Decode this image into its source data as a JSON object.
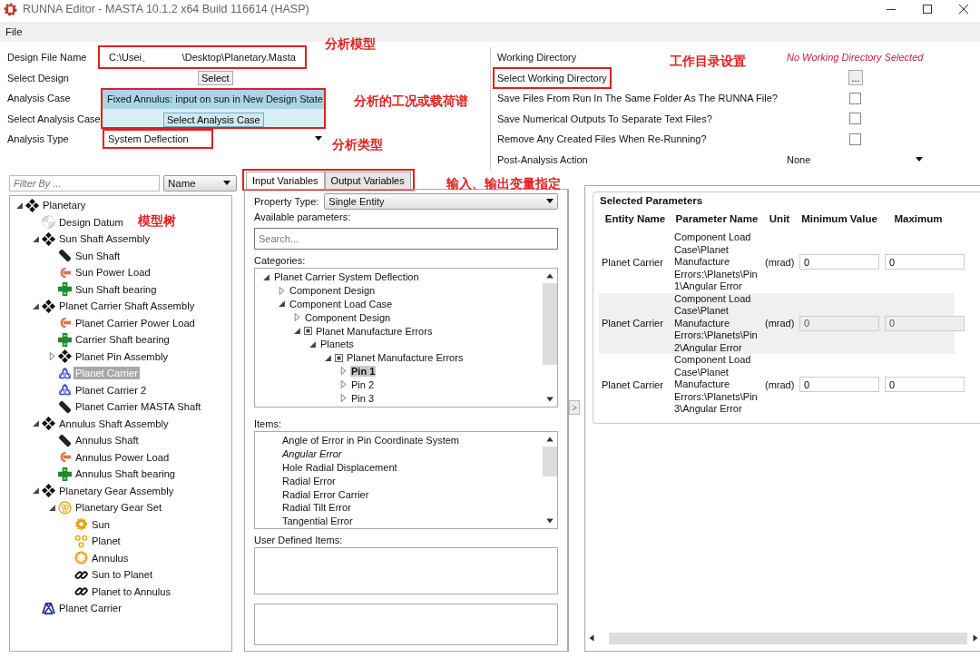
{
  "window": {
    "title": "RUNNA Editor - MASTA 10.1.2 x64 Build 116614 (HASP)"
  },
  "menu": [
    "File"
  ],
  "design": {
    "file": {
      "label": "Design File Name",
      "value": "C:\\Usei、           \\Desktop\\Planetary.Masta",
      "highlighted": true
    },
    "select_design": {
      "label": "Select Design",
      "button": "Select"
    },
    "analysis_case": {
      "label": "Analysis Case",
      "value": "Fixed Annulus: input on sun in New Design State",
      "select_label": "Select Analysis Case",
      "button": "Select Analysis Case",
      "highlighted": true
    },
    "analysis_type": {
      "label": "Analysis Type",
      "value": "System Deflection",
      "highlighted": true
    }
  },
  "settings": {
    "rows": [
      {
        "kind": "status",
        "label": "Working Directory",
        "value": "No Working Directory Selected",
        "highlighted": false
      },
      {
        "kind": "browse",
        "label": "Select Working Directory",
        "button": "...",
        "highlighted": true
      },
      {
        "kind": "checkbox",
        "label": "Save Files From Run In The Same Folder As The RUNNA File?",
        "checked": false,
        "highlighted": false
      },
      {
        "kind": "checkbox",
        "label": "Save Numerical Outputs To Separate Text Files?",
        "checked": false,
        "highlighted": false
      },
      {
        "kind": "checkbox",
        "label": "Remove Any Created Files When Re-Running?",
        "checked": false,
        "highlighted": false
      },
      {
        "kind": "dropdown",
        "label": "Post-Analysis Action",
        "value": "None",
        "highlighted": false
      }
    ]
  },
  "tree": {
    "filter_placeholder": "Filter By ...",
    "sort": "Name",
    "items": [
      {
        "label": "Planetary",
        "kind": "assembly",
        "expanded": true,
        "selected": false,
        "children": [
          {
            "label": "Design Datum",
            "kind": "datum",
            "selected": false
          },
          {
            "label": "Sun Shaft Assembly",
            "kind": "assembly",
            "expanded": true,
            "selected": false,
            "children": [
              {
                "label": "Sun Shaft",
                "kind": "shaft",
                "selected": false
              },
              {
                "label": "Sun Power Load",
                "kind": "load",
                "selected": false
              },
              {
                "label": "Sun Shaft bearing",
                "kind": "bearing",
                "selected": false
              }
            ]
          },
          {
            "label": "Planet Carrier Shaft Assembly",
            "kind": "assembly",
            "expanded": true,
            "selected": false,
            "children": [
              {
                "label": "Planet Carrier Power Load",
                "kind": "load",
                "selected": false
              },
              {
                "label": "Carrier Shaft bearing",
                "kind": "bearing",
                "selected": false
              },
              {
                "label": "Planet Pin Assembly",
                "kind": "assembly",
                "expanded": false,
                "selected": false
              },
              {
                "label": "Planet Carrier",
                "kind": "carrier",
                "selected": true
              },
              {
                "label": "Planet Carrier 2",
                "kind": "carrier",
                "selected": false
              },
              {
                "label": "Planet Carrier MASTA Shaft",
                "kind": "shaft",
                "selected": false
              }
            ]
          },
          {
            "label": "Annulus Shaft Assembly",
            "kind": "assembly",
            "expanded": true,
            "selected": false,
            "children": [
              {
                "label": "Annulus Shaft",
                "kind": "shaft",
                "selected": false
              },
              {
                "label": "Annulus Power Load",
                "kind": "load",
                "selected": false
              },
              {
                "label": "Annulus Shaft bearing",
                "kind": "bearing",
                "selected": false
              }
            ]
          },
          {
            "label": "Planetary Gear Assembly",
            "kind": "assembly",
            "expanded": true,
            "selected": false,
            "children": [
              {
                "label": "Planetary Gear Set",
                "kind": "gearset",
                "expanded": true,
                "selected": false,
                "children": [
                  {
                    "label": "Sun",
                    "kind": "sun",
                    "selected": false
                  },
                  {
                    "label": "Planet",
                    "kind": "planet",
                    "selected": false
                  },
                  {
                    "label": "Annulus",
                    "kind": "annulus",
                    "selected": false
                  },
                  {
                    "label": "Sun to Planet",
                    "kind": "link",
                    "selected": false
                  },
                  {
                    "label": "Planet to Annulus",
                    "kind": "link",
                    "selected": false
                  }
                ]
              }
            ]
          },
          {
            "label": "Planet Carrier",
            "kind": "frame",
            "selected": false
          }
        ]
      }
    ]
  },
  "tabs": [
    {
      "label": "Input Variables",
      "selected": true
    },
    {
      "label": "Output Variables",
      "selected": false
    }
  ],
  "tabs_highlighted": true,
  "inputs": {
    "property_type_label": "Property Type:",
    "property_type": "Single Entity",
    "available_label": "Available parameters:",
    "search_placeholder": "Search...",
    "categories_label": "Categories:",
    "categories": [
      {
        "label": "Planet Carrier System Deflection",
        "expanded": true,
        "selected": false,
        "children": [
          {
            "label": "Component Design",
            "expanded": false,
            "selected": false
          },
          {
            "label": "Component Load Case",
            "expanded": true,
            "selected": false,
            "children": [
              {
                "label": "Component Design",
                "expanded": false,
                "selected": false
              },
              {
                "label": "Planet Manufacture Errors",
                "kind": "group",
                "expanded": true,
                "selected": false,
                "children": [
                  {
                    "label": "Planets",
                    "expanded": true,
                    "selected": false,
                    "children": [
                      {
                        "label": "Planet Manufacture Errors",
                        "kind": "group",
                        "expanded": true,
                        "selected": false,
                        "children": [
                          {
                            "label": "Pin 1",
                            "expanded": false,
                            "selected": true
                          },
                          {
                            "label": "Pin 2",
                            "expanded": false,
                            "selected": false
                          },
                          {
                            "label": "Pin 3",
                            "expanded": false,
                            "selected": false
                          }
                        ]
                      }
                    ]
                  }
                ]
              }
            ]
          }
        ]
      }
    ],
    "items_label": "Items:",
    "items": [
      {
        "label": "Angle of Error in Pin Coordinate System",
        "added": false
      },
      {
        "label": "Angular Error",
        "added": true
      },
      {
        "label": "Hole Radial Displacement",
        "added": false
      },
      {
        "label": "Radial Error",
        "added": false
      },
      {
        "label": "Radial Error Carrier",
        "added": false
      },
      {
        "label": "Radial Tilt Error",
        "added": false
      },
      {
        "label": "Tangential Error",
        "added": false
      }
    ],
    "user_defined_label": "User Defined Items:",
    "add_button": ">"
  },
  "selected_parameters": {
    "title": "Selected Parameters",
    "columns": [
      "Entity Name",
      "Parameter Name",
      "Unit",
      "Minimum Value",
      "Maximum"
    ],
    "rows": [
      {
        "entity": "Planet Carrier",
        "parameter": "Component Load Case\\Planet Manufacture Errors:\\Planets\\Pin 1\\Angular Error",
        "unit": "(mrad)",
        "min": "0",
        "max": "0",
        "disabled": false
      },
      {
        "entity": "Planet Carrier",
        "parameter": "Component Load Case\\Planet Manufacture Errors:\\Planets\\Pin 2\\Angular Error",
        "unit": "(mrad)",
        "min": "0",
        "max": "0",
        "disabled": true
      },
      {
        "entity": "Planet Carrier",
        "parameter": "Component Load Case\\Planet Manufacture Errors:\\Planets\\Pin 3\\Angular Error",
        "unit": "(mrad)",
        "min": "0",
        "max": "0",
        "disabled": false
      }
    ]
  },
  "annotations": [
    {
      "text": "分析模型"
    },
    {
      "text": "分析的工况或载荷谱"
    },
    {
      "text": "分析类型"
    },
    {
      "text": "工作目录设置"
    },
    {
      "text": "模型树"
    },
    {
      "text": "输入、输出变量指定"
    }
  ]
}
